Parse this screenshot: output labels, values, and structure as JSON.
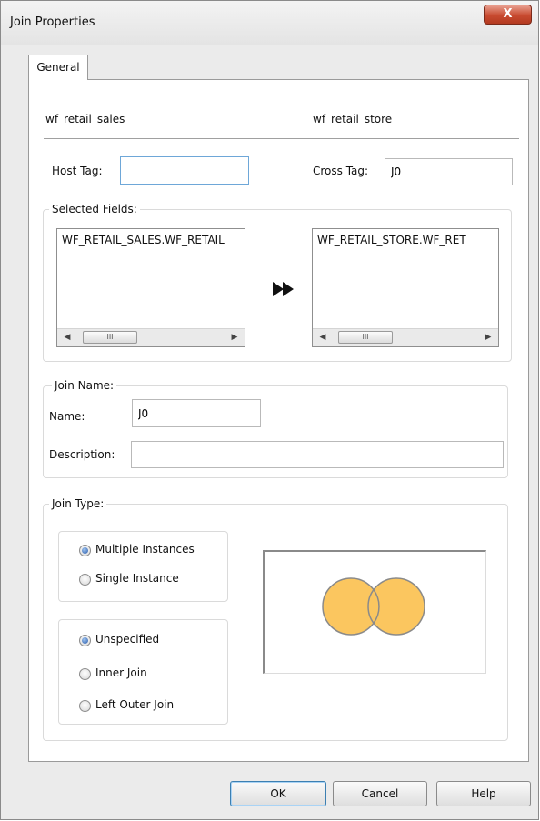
{
  "window": {
    "title": "Join Properties",
    "close_symbol": "X"
  },
  "tabs": [
    {
      "label": "General",
      "active": true
    }
  ],
  "tables": {
    "host": "wf_retail_sales",
    "cross": "wf_retail_store"
  },
  "host_tag": {
    "label": "Host Tag:",
    "value": ""
  },
  "cross_tag": {
    "label": "Cross Tag:",
    "value": "J0"
  },
  "selected_fields": {
    "legend": "Selected Fields:",
    "host_items": [
      "WF_RETAIL_SALES.WF_RETAIL"
    ],
    "cross_items": [
      "WF_RETAIL_STORE.WF_RET"
    ],
    "arrow_icon": "double-arrow-right-icon"
  },
  "join_name": {
    "legend": "Join Name:",
    "name_label": "Name:",
    "name_value": "J0",
    "description_label": "Description:",
    "description_value": ""
  },
  "join_type": {
    "legend": "Join Type:",
    "instance_options": [
      {
        "label": "Multiple Instances",
        "selected": true
      },
      {
        "label": "Single Instance",
        "selected": false
      }
    ],
    "join_options": [
      {
        "label": "Unspecified",
        "selected": true
      },
      {
        "label": "Inner Join",
        "selected": false
      },
      {
        "label": "Left Outer Join",
        "selected": false
      }
    ],
    "venn_fill": "#fbc65f",
    "venn_stroke": "#8a8a8a"
  },
  "scroll_glyphs": {
    "left": "◀",
    "right": "▶",
    "thumb": "III"
  },
  "buttons": {
    "ok": "OK",
    "cancel": "Cancel",
    "help": "Help"
  },
  "colors": {
    "close_button": "#c84a30",
    "focus_border": "#6ea7d8",
    "radio_selected": "#2a5caa"
  }
}
